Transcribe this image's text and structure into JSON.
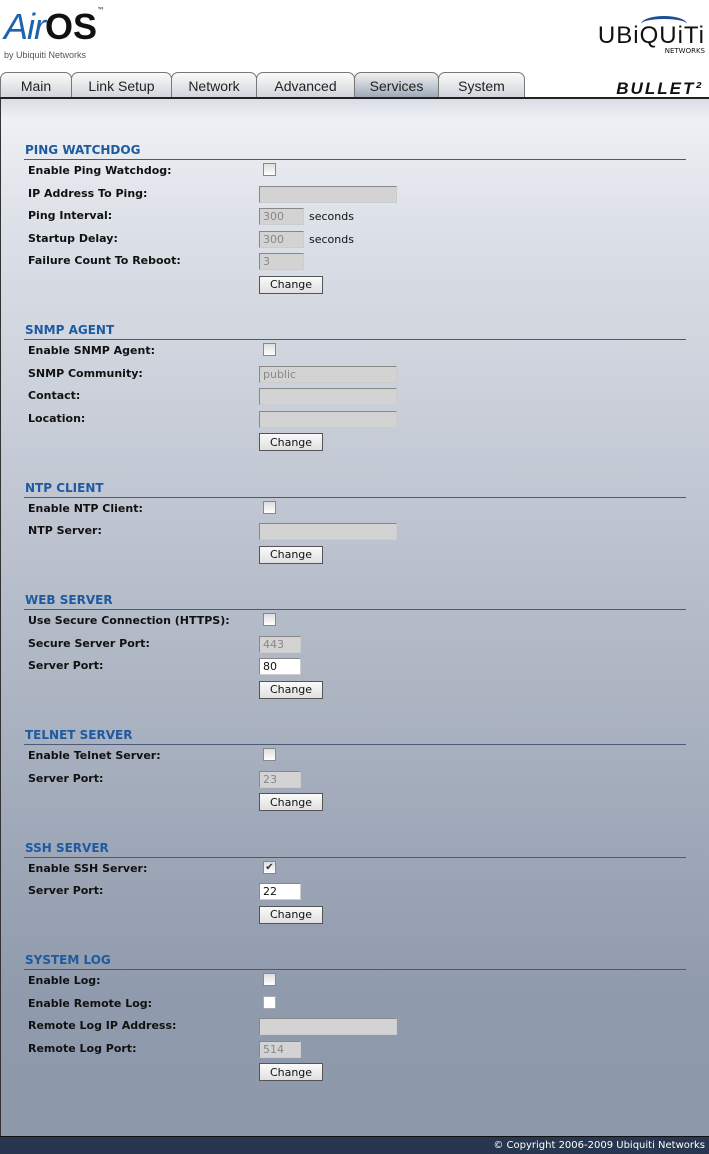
{
  "header": {
    "logo_air": "Air",
    "logo_os": "OS",
    "logo_tm": "™",
    "logo_by": "by Ubiquiti Networks",
    "brand": "UBiQUiTi",
    "brand_sub": "NETWORKS",
    "product": "BULLET²"
  },
  "tabs": [
    {
      "label": "Main",
      "active": false
    },
    {
      "label": "Link Setup",
      "active": false
    },
    {
      "label": "Network",
      "active": false
    },
    {
      "label": "Advanced",
      "active": false
    },
    {
      "label": "Services",
      "active": true
    },
    {
      "label": "System",
      "active": false
    }
  ],
  "sections": [
    {
      "title": "PING WATCHDOG",
      "rows": [
        {
          "label": "Enable Ping Watchdog:",
          "type": "checkbox",
          "checked": false
        },
        {
          "label": "IP Address To Ping:",
          "type": "text",
          "size": "wide",
          "value": "",
          "enabled": false
        },
        {
          "label": "Ping Interval:",
          "type": "text",
          "size": "mid",
          "value": "300",
          "enabled": false,
          "suffix": "seconds"
        },
        {
          "label": "Startup Delay:",
          "type": "text",
          "size": "mid",
          "value": "300",
          "enabled": false,
          "suffix": "seconds"
        },
        {
          "label": "Failure Count To Reboot:",
          "type": "text",
          "size": "mid",
          "value": "3",
          "enabled": false
        },
        {
          "label": "",
          "type": "button",
          "value": "Change"
        }
      ]
    },
    {
      "title": "SNMP AGENT",
      "rows": [
        {
          "label": "Enable SNMP Agent:",
          "type": "checkbox",
          "checked": false
        },
        {
          "label": "SNMP Community:",
          "type": "text",
          "size": "wide",
          "value": "public",
          "enabled": false
        },
        {
          "label": "Contact:",
          "type": "text",
          "size": "wide",
          "value": "",
          "enabled": false
        },
        {
          "label": "Location:",
          "type": "text",
          "size": "wide",
          "value": "",
          "enabled": false
        },
        {
          "label": "",
          "type": "button",
          "value": "Change"
        }
      ]
    },
    {
      "title": "NTP CLIENT",
      "rows": [
        {
          "label": "Enable NTP Client:",
          "type": "checkbox",
          "checked": false
        },
        {
          "label": "NTP Server:",
          "type": "text",
          "size": "wide",
          "value": "",
          "enabled": false
        },
        {
          "label": "",
          "type": "button",
          "value": "Change"
        }
      ]
    },
    {
      "title": "WEB SERVER",
      "rows": [
        {
          "label": "Use Secure Connection (HTTPS):",
          "type": "checkbox",
          "checked": false
        },
        {
          "label": "Secure Server Port:",
          "type": "text",
          "size": "small",
          "value": "443",
          "enabled": false
        },
        {
          "label": "Server Port:",
          "type": "text",
          "size": "small",
          "value": "80",
          "enabled": true
        },
        {
          "label": "",
          "type": "button",
          "value": "Change"
        }
      ]
    },
    {
      "title": "TELNET SERVER",
      "rows": [
        {
          "label": "Enable Telnet Server:",
          "type": "checkbox",
          "checked": false
        },
        {
          "label": "Server Port:",
          "type": "text",
          "size": "small",
          "value": "23",
          "enabled": false
        },
        {
          "label": "",
          "type": "button",
          "value": "Change"
        }
      ]
    },
    {
      "title": "SSH SERVER",
      "rows": [
        {
          "label": "Enable SSH Server:",
          "type": "checkbox",
          "checked": true
        },
        {
          "label": "Server Port:",
          "type": "text",
          "size": "small",
          "value": "22",
          "enabled": true
        },
        {
          "label": "",
          "type": "button",
          "value": "Change"
        }
      ]
    },
    {
      "title": "SYSTEM LOG",
      "rows": [
        {
          "label": "Enable Log:",
          "type": "checkbox",
          "checked": false
        },
        {
          "label": "Enable Remote Log:",
          "type": "checkbox",
          "checked": false,
          "white": true
        },
        {
          "label": "Remote Log IP Address:",
          "type": "text",
          "size": "wide",
          "value": "",
          "enabled": false
        },
        {
          "label": "Remote Log Port:",
          "type": "text",
          "size": "small",
          "value": "514",
          "enabled": false
        },
        {
          "label": "",
          "type": "button",
          "value": "Change"
        }
      ]
    }
  ],
  "footer": {
    "copyright": "© Copyright 2006-2009 Ubiquiti Networks"
  }
}
